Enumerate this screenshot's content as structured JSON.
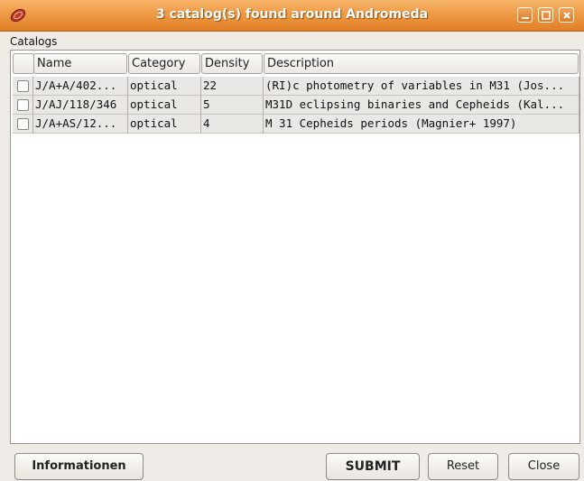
{
  "window": {
    "title": "3 catalog(s) found around Andromeda",
    "icon": "catalog-disc-icon",
    "controls": [
      "minimize-icon",
      "maximize-icon",
      "close-icon"
    ]
  },
  "catalogs": {
    "label": "Catalogs",
    "columns": [
      "Name",
      "Category",
      "Density",
      "Description"
    ],
    "rows": [
      {
        "name": "J/A+A/402...",
        "category": "optical",
        "density": "22",
        "description": "(RI)c photometry of variables in M31 (Jos..."
      },
      {
        "name": "J/AJ/118/346",
        "category": "optical",
        "density": "5",
        "description": "M31D eclipsing binaries and Cepheids (Kal..."
      },
      {
        "name": "J/A+AS/12...",
        "category": "optical",
        "density": "4",
        "description": "M 31 Cepheids periods (Magnier+ 1997)"
      }
    ]
  },
  "buttons": {
    "informationen": "Informationen",
    "submit": "SUBMIT",
    "reset": "Reset",
    "close": "Close"
  },
  "colors": {
    "titlebar": "#ee9a45",
    "window_bg": "#efebe7",
    "table_bg": "#ffffff",
    "row_bg": "#eae8e4"
  }
}
